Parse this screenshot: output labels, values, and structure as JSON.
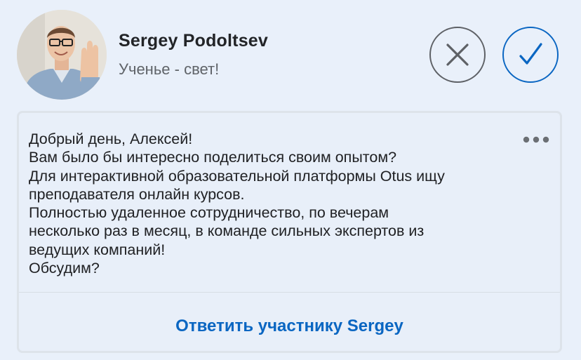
{
  "sender": {
    "name": "Sergey Podoltsev",
    "headline": "Ученье - свет!"
  },
  "actions": {
    "decline_icon": "close-icon",
    "accept_icon": "check-icon",
    "more_icon": "more-horizontal-icon"
  },
  "message": {
    "lines": [
      "Добрый день, Алексей!",
      "Вам было бы интересно поделиться своим опытом?",
      "Для интерактивной образовательной платформы Otus ищу",
      "преподавателя онлайн курсов.",
      "Полностью удаленное сотрудничество, по вечерам",
      "несколько раз в месяц, в команде сильных экспертов из",
      "ведущих компаний!",
      "Обсудим?"
    ]
  },
  "reply": {
    "label": "Ответить участнику Sergey"
  },
  "colors": {
    "background": "#e9f0fa",
    "accent": "#0a66c2",
    "text": "#202124",
    "muted": "#5f6368"
  }
}
